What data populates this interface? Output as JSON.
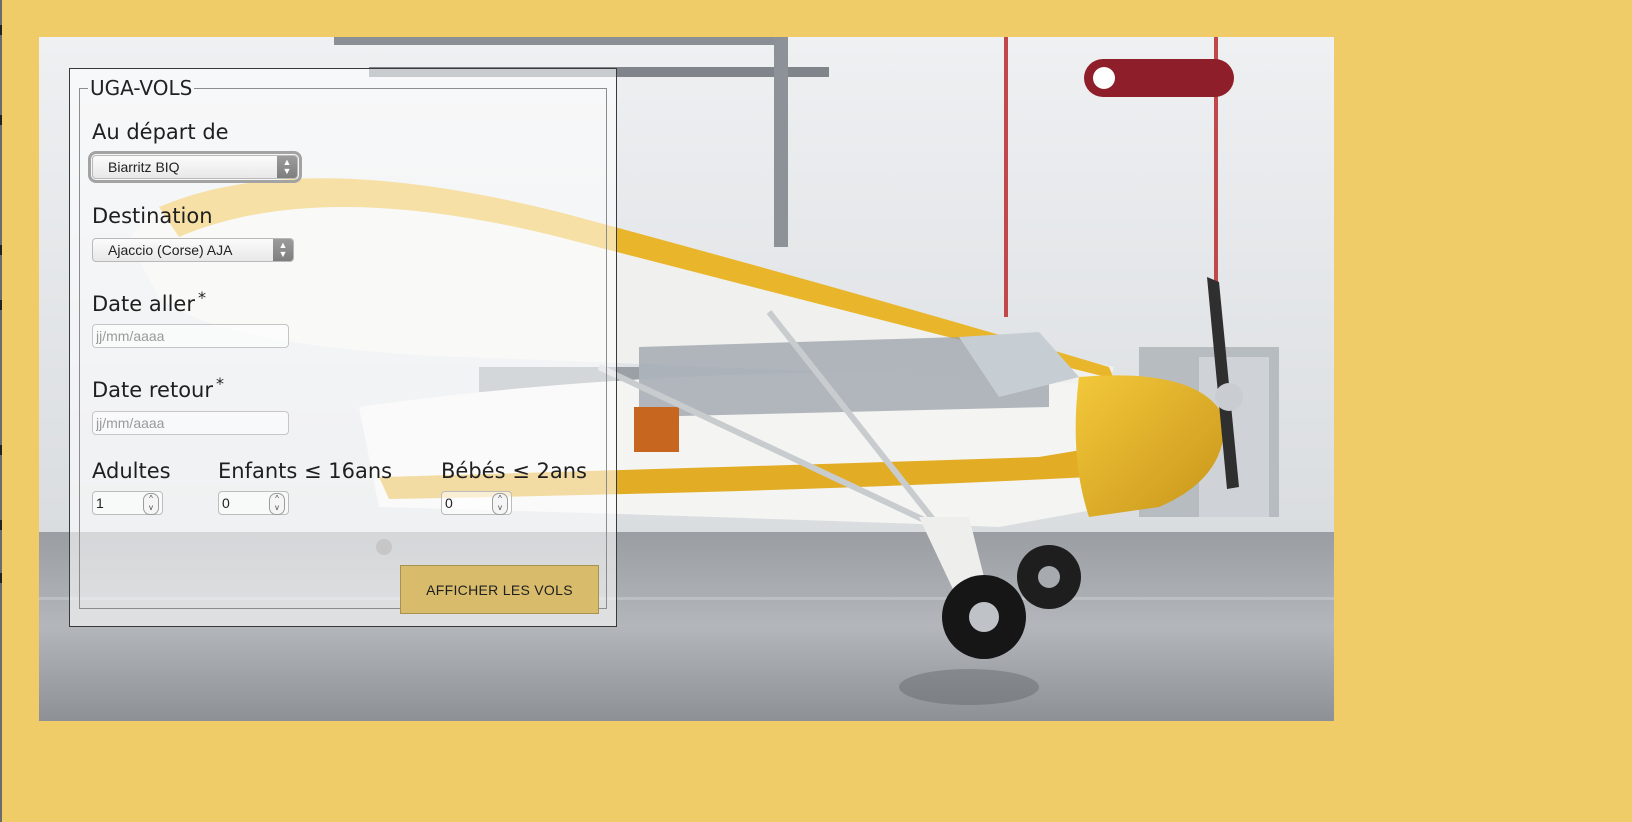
{
  "form": {
    "title": "UGA-VOLS",
    "departure": {
      "label": "Au départ de",
      "selected": "Biarritz BIQ"
    },
    "destination": {
      "label": "Destination",
      "selected": "Ajaccio (Corse) AJA"
    },
    "date_aller": {
      "label": "Date aller",
      "required_mark": "*",
      "placeholder": "jj/mm/aaaa"
    },
    "date_retour": {
      "label": "Date retour",
      "required_mark": "*",
      "placeholder": "jj/mm/aaaa"
    },
    "adults": {
      "label": "Adultes",
      "value": "1"
    },
    "children": {
      "label": "Enfants ≤ 16ans",
      "value": "0"
    },
    "babies": {
      "label": "Bébés ≤ 2ans",
      "value": "0"
    },
    "submit_label": "AFFICHER LES VOLS"
  },
  "colors": {
    "page_background": "#f0cc68",
    "button_background": "#d8bc6b",
    "plane_yellow": "#e7b526"
  },
  "background_image": "hangar with yellow and white light aircraft"
}
